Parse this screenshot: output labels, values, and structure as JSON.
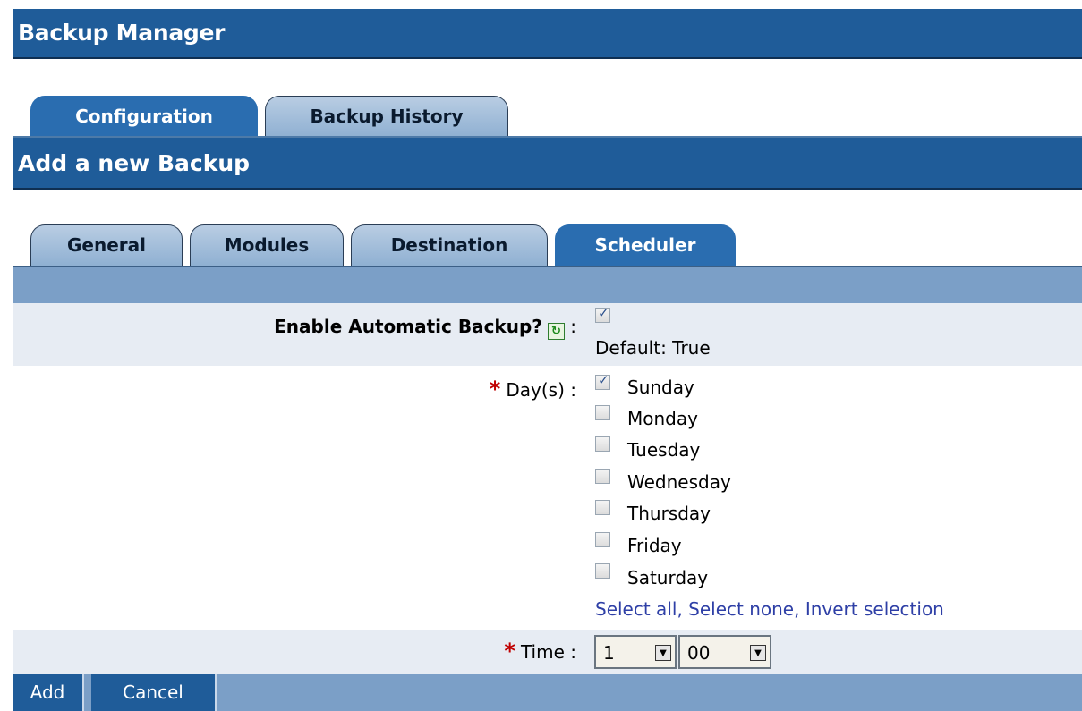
{
  "app": {
    "title": "Backup Manager"
  },
  "top_tabs": [
    {
      "label": "Configuration",
      "active": true
    },
    {
      "label": "Backup History",
      "active": false
    }
  ],
  "section": {
    "title": "Add a new Backup"
  },
  "inner_tabs": [
    {
      "label": "General",
      "active": false
    },
    {
      "label": "Modules",
      "active": false
    },
    {
      "label": "Destination",
      "active": false
    },
    {
      "label": "Scheduler",
      "active": true
    }
  ],
  "form": {
    "enable": {
      "label": "Enable Automatic Backup?",
      "colon": ":",
      "checked": true,
      "default_text": "Default: True",
      "help_icon": "refresh-icon"
    },
    "days": {
      "required_mark": "*",
      "label": "Day(s)",
      "colon": ":",
      "options": [
        {
          "label": "Sunday",
          "checked": true
        },
        {
          "label": "Monday",
          "checked": false
        },
        {
          "label": "Tuesday",
          "checked": false
        },
        {
          "label": "Wednesday",
          "checked": false
        },
        {
          "label": "Thursday",
          "checked": false
        },
        {
          "label": "Friday",
          "checked": false
        },
        {
          "label": "Saturday",
          "checked": false
        }
      ],
      "links": {
        "select_all": "Select all",
        "select_none": "Select none",
        "invert": "Invert selection",
        "sep": ","
      }
    },
    "time": {
      "required_mark": "*",
      "label": "Time",
      "colon": ":",
      "hour": "1",
      "minute": "00"
    }
  },
  "buttons": {
    "add": "Add",
    "cancel": "Cancel"
  },
  "colors": {
    "header_blue": "#1f5c99",
    "bar_blue": "#7b9fc7",
    "required_red": "#c00000",
    "link_blue": "#2e3fa6"
  }
}
